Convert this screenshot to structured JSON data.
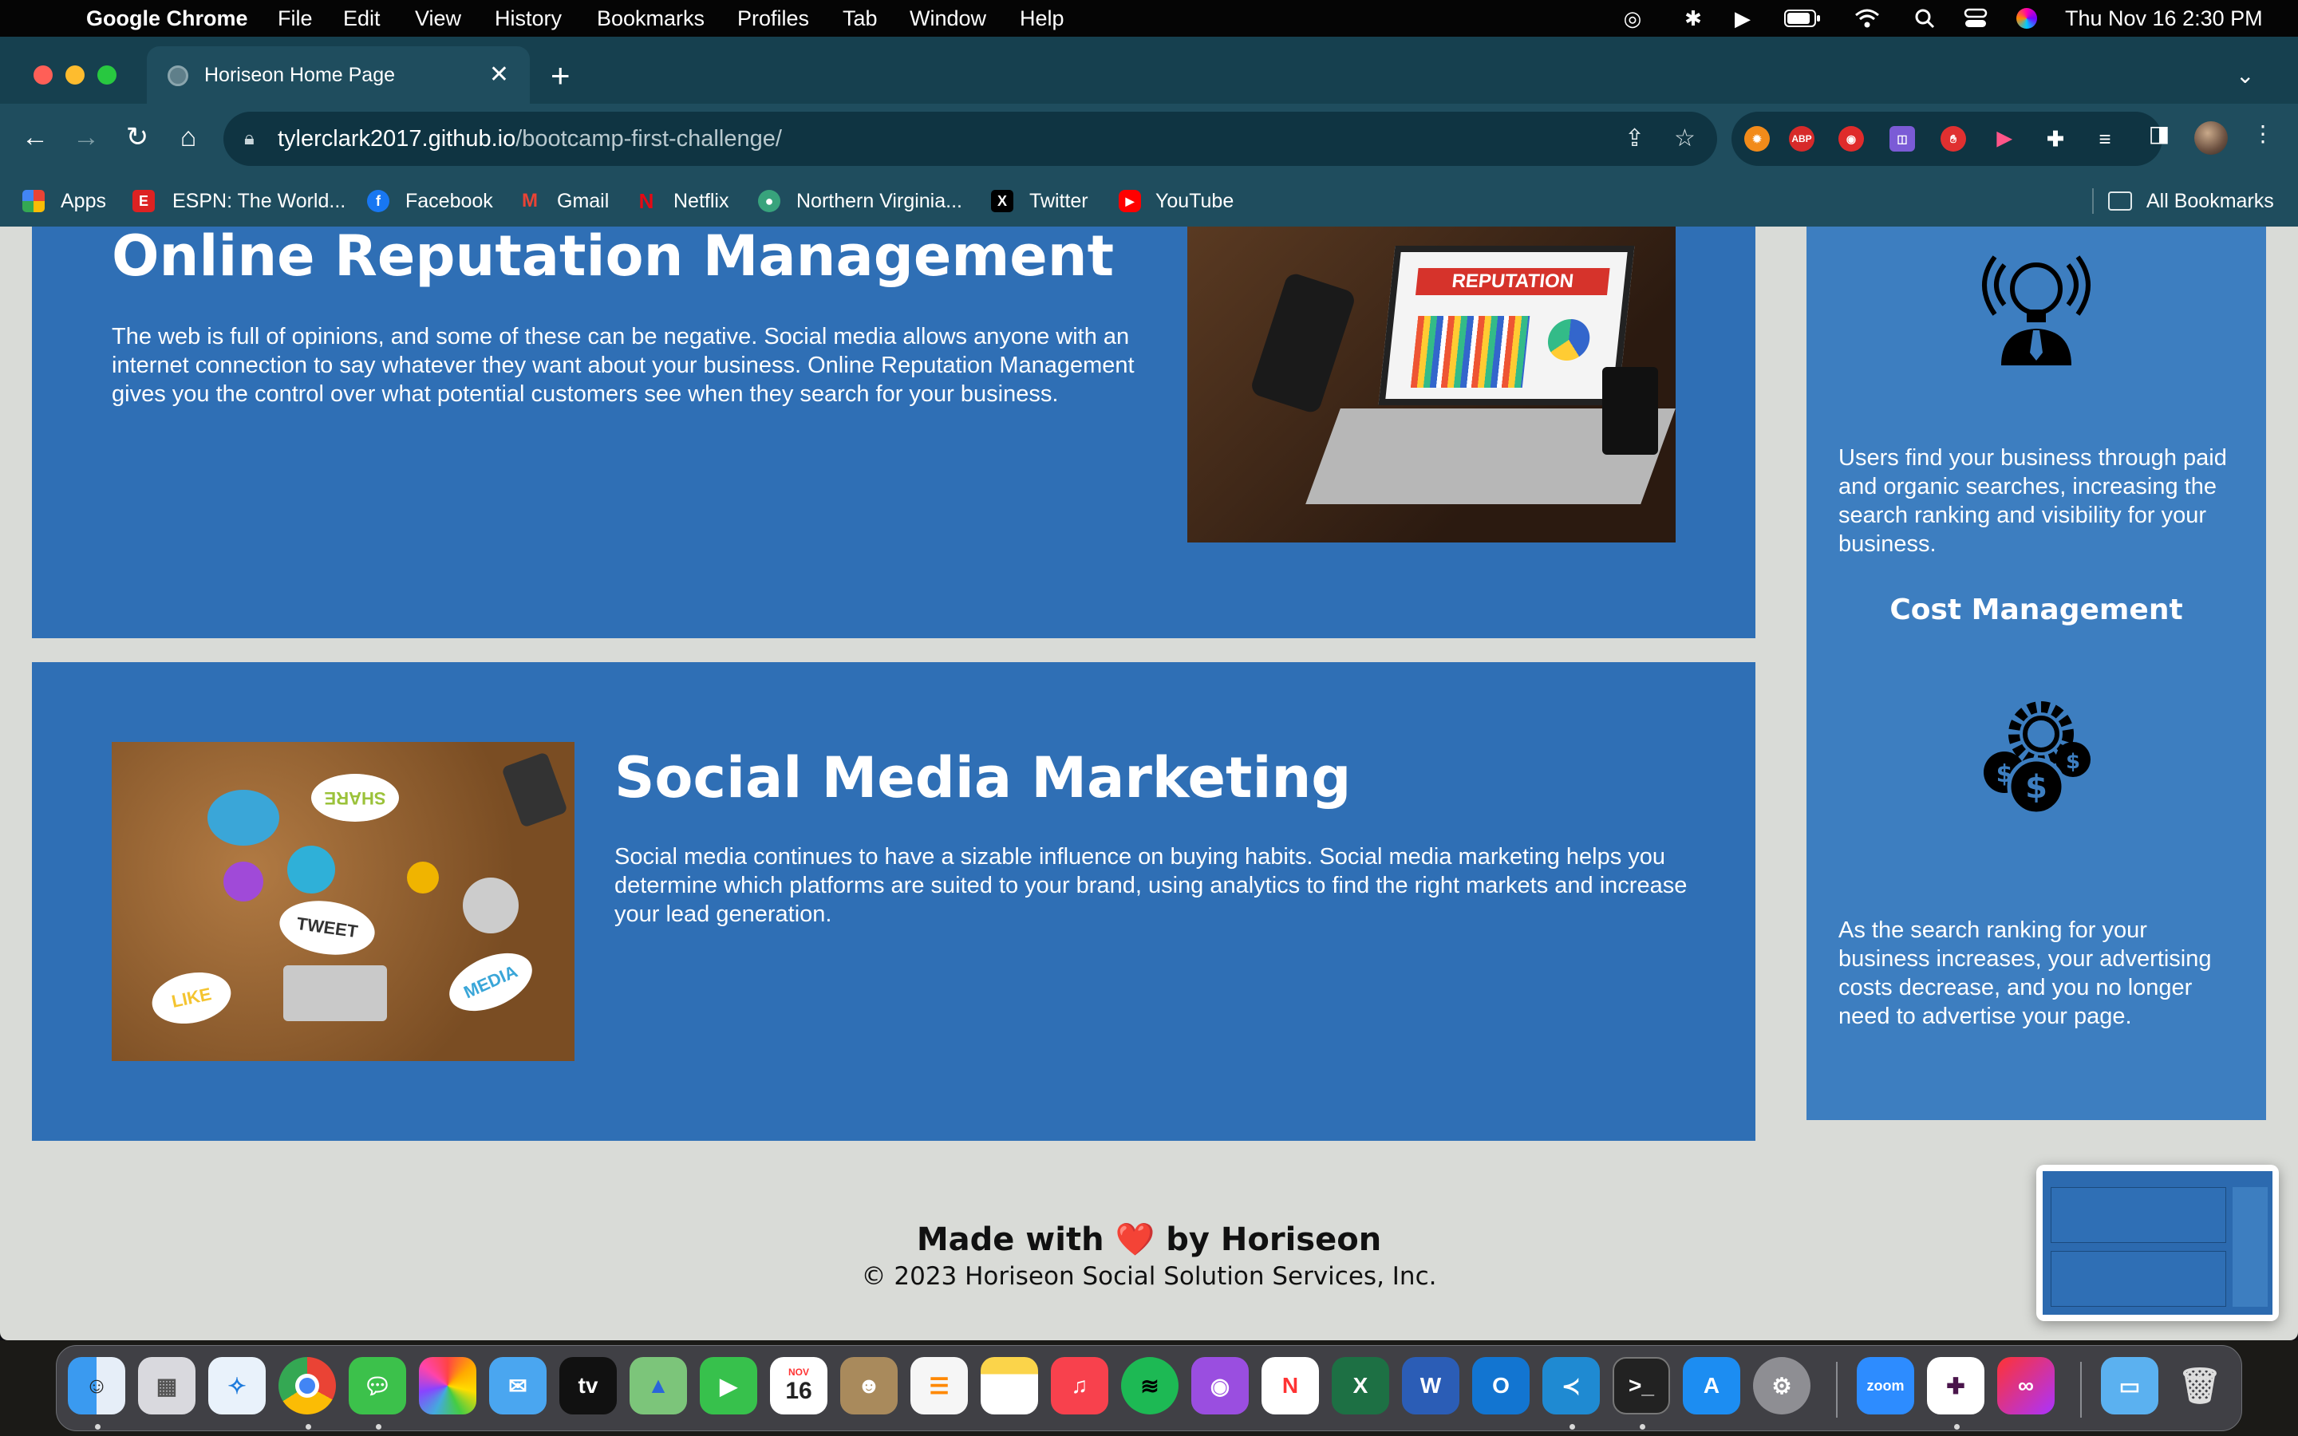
{
  "menubar": {
    "app_name": "Google Chrome",
    "items": [
      "File",
      "Edit",
      "View",
      "History",
      "Bookmarks",
      "Profiles",
      "Tab",
      "Window",
      "Help"
    ],
    "clock": "Thu Nov 16  2:30 PM"
  },
  "browser": {
    "tab_title": "Horiseon Home Page",
    "tab_close": "✕",
    "new_tab": "+",
    "url_host": "tylerclark2017.github.io",
    "url_path": "/bootcamp-first-challenge/",
    "bookmarks": [
      "Apps",
      "ESPN: The World...",
      "Facebook",
      "Gmail",
      "Netflix",
      "Northern Virginia...",
      "Twitter",
      "YouTube"
    ],
    "all_bookmarks": "All Bookmarks",
    "extension_abp": "ABP"
  },
  "page": {
    "orm": {
      "title": "Online Reputation Management",
      "body": "The web is full of opinions, and some of these can be negative. Social media allows anyone with an internet connection to say whatever they want about your business. Online Reputation Management gives you the control over what potential customers see when they search for your business.",
      "image_label": "REPUTATION"
    },
    "smm": {
      "title": "Social Media Marketing",
      "body": "Social media continues to have a sizable influence on buying habits. Social media marketing helps you determine which platforms are suited to your brand, using analytics to find the right markets and increase your lead generation.",
      "image_words": [
        "SHARE",
        "TWEET",
        "LIKE",
        "MEDIA"
      ]
    },
    "sidebar": {
      "lead_text": "Users find your business through paid and organic searches, increasing the search ranking and visibility for your business.",
      "cost_title": "Cost Management",
      "cost_text": "As the search ranking for your business increases, your advertising costs decrease, and you no longer need to advertise your page."
    },
    "footer": {
      "made_prefix": "Made with",
      "heart": "❤️",
      "made_suffix": "by Horiseon",
      "copyright": "© 2023 Horiseon Social Solution Services, Inc."
    }
  },
  "dock": {
    "calendar_month": "NOV",
    "calendar_day": "16",
    "zoom_label": "zoom"
  },
  "colors": {
    "card_blue": "#2f6fb5",
    "sidebar_blue": "#3d7ec0",
    "page_bg": "#d9dbd7",
    "chrome_teal": "#1f4d5e"
  }
}
